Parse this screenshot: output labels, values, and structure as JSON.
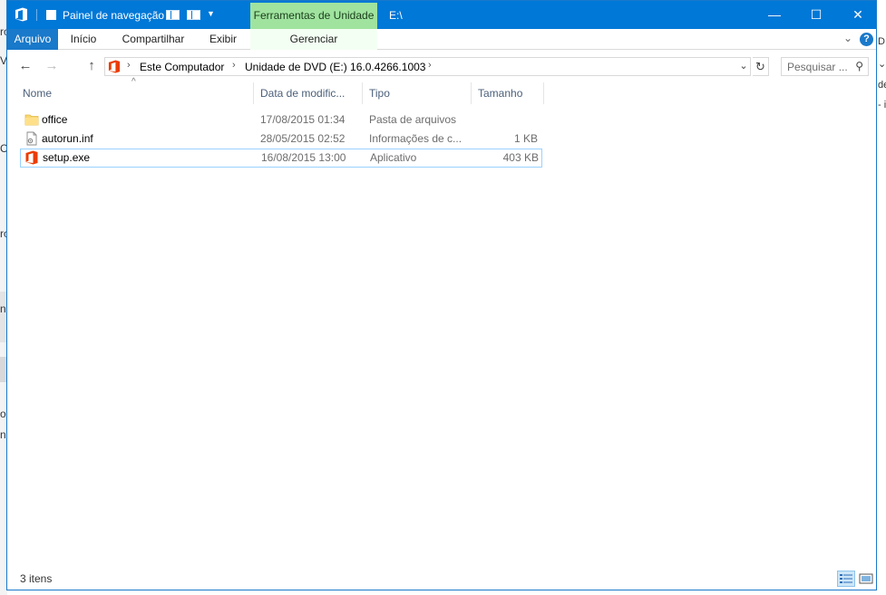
{
  "titlebar": {
    "quick_access_label": "Painel de navegação",
    "contextual_tab": "Ferramentas de Unidade",
    "path_title": "E:\\",
    "minimize_glyph": "—",
    "maximize_glyph": "☐",
    "close_glyph": "✕"
  },
  "ribbon": {
    "tabs": [
      "Arquivo",
      "Início",
      "Compartilhar",
      "Exibir"
    ],
    "contextual_sub_tab": "Gerenciar",
    "collapse_glyph": "⌄",
    "help_glyph": "?"
  },
  "navigation": {
    "back_glyph": "←",
    "forward_glyph": "→",
    "up_glyph": "↑",
    "breadcrumb": [
      "Este Computador",
      "Unidade de DVD (E:) 16.0.4266.1003"
    ],
    "chevron_glyph": "›",
    "dropdown_glyph": "⌄",
    "refresh_glyph": "↻",
    "search_placeholder": "Pesquisar ...",
    "search_glyph": "⚲"
  },
  "columns": [
    "Nome",
    "Data de modific...",
    "Tipo",
    "Tamanho"
  ],
  "sort_glyph": "^",
  "files": [
    {
      "name": "office",
      "date": "17/08/2015 01:34",
      "type": "Pasta de arquivos",
      "size": "",
      "icon": "folder-icon"
    },
    {
      "name": "autorun.inf",
      "date": "28/05/2015 02:52",
      "type": "Informações de c...",
      "size": "1 KB",
      "icon": "document-icon"
    },
    {
      "name": "setup.exe",
      "date": "16/08/2015 13:00",
      "type": "Aplicativo",
      "size": "403 KB",
      "icon": "office-icon"
    }
  ],
  "status": {
    "item_count": "3 itens"
  },
  "background_fragments": {
    "left": [
      "ro",
      "V",
      "C",
      "ro",
      "n",
      "o",
      "n"
    ],
    "right": [
      "D",
      "⌄",
      "de",
      "- i"
    ]
  },
  "colors": {
    "titlebar": "#0078d7",
    "file_tab": "#1979ca",
    "contextual_tab": "#9fe39f",
    "office_orange": "#eb3c00",
    "folder_yellow": "#f8d775",
    "selection_border": "#99d1ff"
  }
}
